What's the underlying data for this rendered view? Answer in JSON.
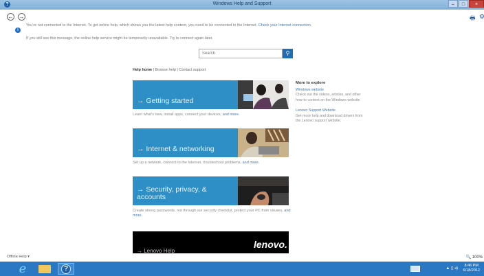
{
  "window": {
    "title": "Windows Help and Support",
    "app_icon": "help-icon",
    "buttons": {
      "minimize": "–",
      "maximize": "□",
      "close": "×"
    }
  },
  "toolbar": {
    "back": "←",
    "forward": "→",
    "print_icon": "print-icon",
    "settings_icon": "gear-icon"
  },
  "notice": {
    "line1": "You're not connected to the Internet. To get online help, which shows you the latest help content, you need to be connected to the Internet.",
    "line1_link": "Check your Internet connection.",
    "line2": "If you still see this message, the online help service might be temporarily unavailable. Try to connect again later."
  },
  "search": {
    "placeholder": "Search",
    "icon": "search-icon"
  },
  "breadcrumb": {
    "home": "Help home",
    "sep1": " | ",
    "browse": "Browse help",
    "sep2": " | ",
    "contact": "Contact support"
  },
  "tiles": [
    {
      "label": "Getting started",
      "desc": "Learn what's new, install apps, connect your devices,",
      "desc_link": "and more."
    },
    {
      "label": "Internet & networking",
      "desc": "Set up a network, connect to the Internet, troubleshoot problems,",
      "desc_link": "and more."
    },
    {
      "label": "Security, privacy, & accounts",
      "desc": "Create strong passwords, not through our security checklist, protect your PC from viruses,",
      "desc_link": "and more."
    }
  ],
  "lenovo": {
    "brand": "lenovo.",
    "label": "Lenovo Help"
  },
  "more": {
    "heading": "More to explore",
    "link1": "Windows website",
    "text1": "Check out the videos, articles, and other how-to content on the Windows website.",
    "link2": "Lenovo Support Website",
    "text2": "Get more help and download drivers from the Lenovo support website."
  },
  "status": {
    "left": "Offline Help ▾",
    "zoom": "🔍 100%"
  },
  "taskbar": {
    "ie_glyph": "e",
    "tray": "▲  ▯  ◂)",
    "time": "8:46 PM",
    "date": "6/18/2012"
  }
}
